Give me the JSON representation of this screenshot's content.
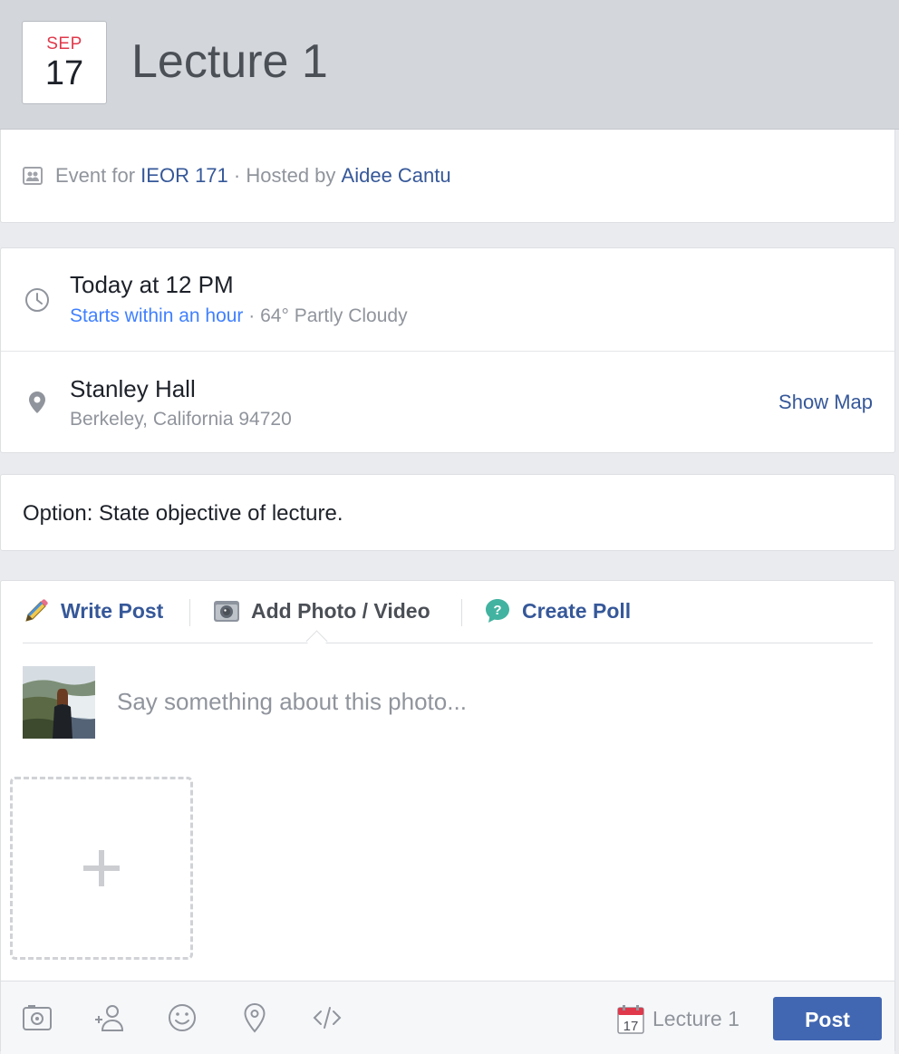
{
  "event": {
    "month": "SEP",
    "day": "17",
    "title": "Lecture 1"
  },
  "host": {
    "event_for_text": "Event for",
    "group_link": "IEOR 171",
    "hosted_by_text": "· Hosted by",
    "host_link": "Aidee Cantu",
    "icon": "group-icon"
  },
  "time": {
    "main": "Today at 12 PM",
    "starts_soon": "Starts within an hour",
    "weather": "· 64° Partly Cloudy",
    "icon": "clock-icon"
  },
  "location": {
    "name": "Stanley Hall",
    "address": "Berkeley, California 94720",
    "show_map_label": "Show Map",
    "icon": "map-pin-icon"
  },
  "description": {
    "text": "Option: State objective of lecture."
  },
  "composer": {
    "tabs": [
      {
        "label": "Write Post",
        "icon": "pencil-icon"
      },
      {
        "label": "Add Photo / Video",
        "icon": "camera-icon"
      },
      {
        "label": "Create Poll",
        "icon": "poll-icon"
      }
    ],
    "placeholder": "Say something about this photo...",
    "footer_icons": [
      "camera-icon",
      "tag-person-icon",
      "emoji-icon",
      "location-icon",
      "code-icon"
    ],
    "event_chip_day": "17",
    "event_chip_label": "Lecture 1",
    "post_label": "Post"
  },
  "colors": {
    "link": "#365899",
    "accent_blue": "#4080ff",
    "post_button": "#4267b2",
    "calendar_red": "#e0394b"
  }
}
